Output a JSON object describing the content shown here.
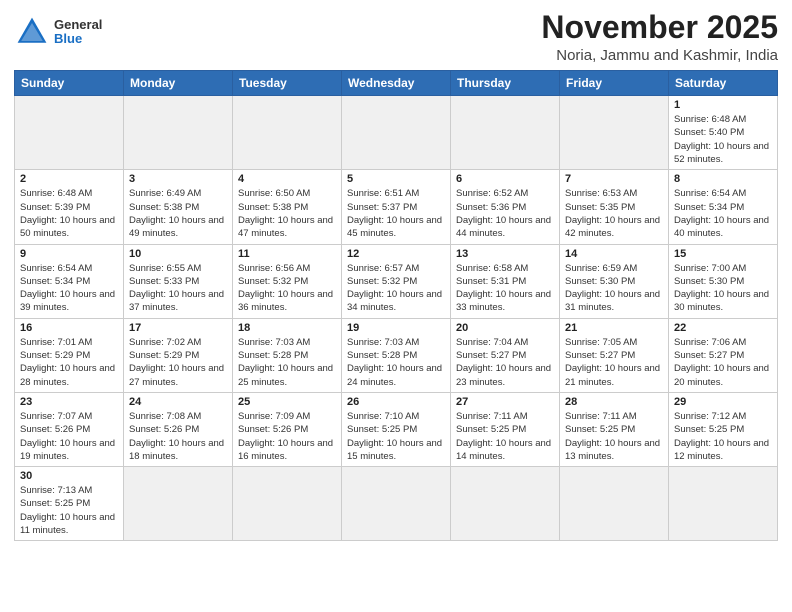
{
  "header": {
    "logo": {
      "general": "General",
      "blue": "Blue"
    },
    "title": "November 2025",
    "location": "Noria, Jammu and Kashmir, India"
  },
  "weekdays": [
    "Sunday",
    "Monday",
    "Tuesday",
    "Wednesday",
    "Thursday",
    "Friday",
    "Saturday"
  ],
  "weeks": [
    [
      {
        "day": "",
        "info": ""
      },
      {
        "day": "",
        "info": ""
      },
      {
        "day": "",
        "info": ""
      },
      {
        "day": "",
        "info": ""
      },
      {
        "day": "",
        "info": ""
      },
      {
        "day": "",
        "info": ""
      },
      {
        "day": "1",
        "info": "Sunrise: 6:48 AM\nSunset: 5:40 PM\nDaylight: 10 hours and 52 minutes."
      }
    ],
    [
      {
        "day": "2",
        "info": "Sunrise: 6:48 AM\nSunset: 5:39 PM\nDaylight: 10 hours and 50 minutes."
      },
      {
        "day": "3",
        "info": "Sunrise: 6:49 AM\nSunset: 5:38 PM\nDaylight: 10 hours and 49 minutes."
      },
      {
        "day": "4",
        "info": "Sunrise: 6:50 AM\nSunset: 5:38 PM\nDaylight: 10 hours and 47 minutes."
      },
      {
        "day": "5",
        "info": "Sunrise: 6:51 AM\nSunset: 5:37 PM\nDaylight: 10 hours and 45 minutes."
      },
      {
        "day": "6",
        "info": "Sunrise: 6:52 AM\nSunset: 5:36 PM\nDaylight: 10 hours and 44 minutes."
      },
      {
        "day": "7",
        "info": "Sunrise: 6:53 AM\nSunset: 5:35 PM\nDaylight: 10 hours and 42 minutes."
      },
      {
        "day": "8",
        "info": "Sunrise: 6:54 AM\nSunset: 5:34 PM\nDaylight: 10 hours and 40 minutes."
      }
    ],
    [
      {
        "day": "9",
        "info": "Sunrise: 6:54 AM\nSunset: 5:34 PM\nDaylight: 10 hours and 39 minutes."
      },
      {
        "day": "10",
        "info": "Sunrise: 6:55 AM\nSunset: 5:33 PM\nDaylight: 10 hours and 37 minutes."
      },
      {
        "day": "11",
        "info": "Sunrise: 6:56 AM\nSunset: 5:32 PM\nDaylight: 10 hours and 36 minutes."
      },
      {
        "day": "12",
        "info": "Sunrise: 6:57 AM\nSunset: 5:32 PM\nDaylight: 10 hours and 34 minutes."
      },
      {
        "day": "13",
        "info": "Sunrise: 6:58 AM\nSunset: 5:31 PM\nDaylight: 10 hours and 33 minutes."
      },
      {
        "day": "14",
        "info": "Sunrise: 6:59 AM\nSunset: 5:30 PM\nDaylight: 10 hours and 31 minutes."
      },
      {
        "day": "15",
        "info": "Sunrise: 7:00 AM\nSunset: 5:30 PM\nDaylight: 10 hours and 30 minutes."
      }
    ],
    [
      {
        "day": "16",
        "info": "Sunrise: 7:01 AM\nSunset: 5:29 PM\nDaylight: 10 hours and 28 minutes."
      },
      {
        "day": "17",
        "info": "Sunrise: 7:02 AM\nSunset: 5:29 PM\nDaylight: 10 hours and 27 minutes."
      },
      {
        "day": "18",
        "info": "Sunrise: 7:03 AM\nSunset: 5:28 PM\nDaylight: 10 hours and 25 minutes."
      },
      {
        "day": "19",
        "info": "Sunrise: 7:03 AM\nSunset: 5:28 PM\nDaylight: 10 hours and 24 minutes."
      },
      {
        "day": "20",
        "info": "Sunrise: 7:04 AM\nSunset: 5:27 PM\nDaylight: 10 hours and 23 minutes."
      },
      {
        "day": "21",
        "info": "Sunrise: 7:05 AM\nSunset: 5:27 PM\nDaylight: 10 hours and 21 minutes."
      },
      {
        "day": "22",
        "info": "Sunrise: 7:06 AM\nSunset: 5:27 PM\nDaylight: 10 hours and 20 minutes."
      }
    ],
    [
      {
        "day": "23",
        "info": "Sunrise: 7:07 AM\nSunset: 5:26 PM\nDaylight: 10 hours and 19 minutes."
      },
      {
        "day": "24",
        "info": "Sunrise: 7:08 AM\nSunset: 5:26 PM\nDaylight: 10 hours and 18 minutes."
      },
      {
        "day": "25",
        "info": "Sunrise: 7:09 AM\nSunset: 5:26 PM\nDaylight: 10 hours and 16 minutes."
      },
      {
        "day": "26",
        "info": "Sunrise: 7:10 AM\nSunset: 5:25 PM\nDaylight: 10 hours and 15 minutes."
      },
      {
        "day": "27",
        "info": "Sunrise: 7:11 AM\nSunset: 5:25 PM\nDaylight: 10 hours and 14 minutes."
      },
      {
        "day": "28",
        "info": "Sunrise: 7:11 AM\nSunset: 5:25 PM\nDaylight: 10 hours and 13 minutes."
      },
      {
        "day": "29",
        "info": "Sunrise: 7:12 AM\nSunset: 5:25 PM\nDaylight: 10 hours and 12 minutes."
      }
    ],
    [
      {
        "day": "30",
        "info": "Sunrise: 7:13 AM\nSunset: 5:25 PM\nDaylight: 10 hours and 11 minutes."
      },
      {
        "day": "",
        "info": ""
      },
      {
        "day": "",
        "info": ""
      },
      {
        "day": "",
        "info": ""
      },
      {
        "day": "",
        "info": ""
      },
      {
        "day": "",
        "info": ""
      },
      {
        "day": "",
        "info": ""
      }
    ]
  ]
}
